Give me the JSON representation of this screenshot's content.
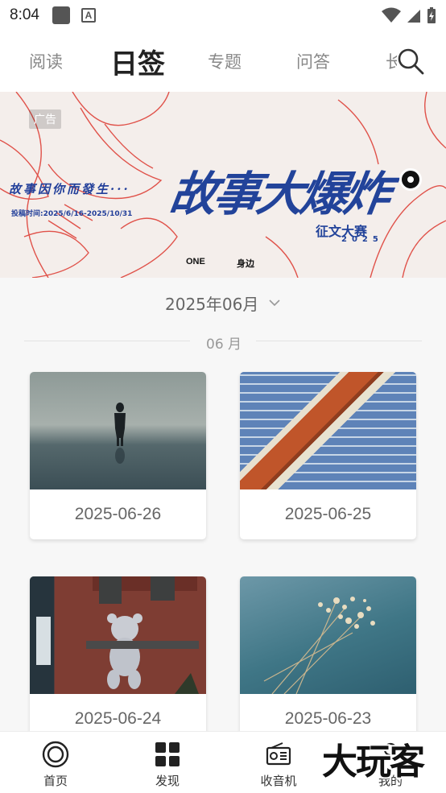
{
  "status_bar": {
    "time": "8:04",
    "notification_icon_letter": "A"
  },
  "top_tabs": [
    {
      "label": "阅读",
      "active": false
    },
    {
      "label": "日签",
      "active": true
    },
    {
      "label": "专题",
      "active": false
    },
    {
      "label": "问答",
      "active": false
    },
    {
      "label": "长",
      "active": false
    }
  ],
  "banner": {
    "ad_tag": "广告",
    "subtitle": "故事因你而發生···",
    "submission_period": "投稿时间:2025/6/16-2025/10/31",
    "title": "故事大爆炸",
    "contest": "征文大赛",
    "year": "2025",
    "brand_one": "ONE",
    "brand_side": "身边"
  },
  "month_selector": {
    "value": "2025年06月"
  },
  "month_heading": "06 月",
  "cards": [
    {
      "date": "2025-06-26",
      "image": "person-standing-in-sea"
    },
    {
      "date": "2025-06-25",
      "image": "mosaic-tiles"
    },
    {
      "date": "2025-06-24",
      "image": "teddy-bear-on-building"
    },
    {
      "date": "2025-06-23",
      "image": "dried-flowers-bouquet"
    }
  ],
  "bottom_nav": [
    {
      "label": "首页",
      "icon": "home-circle-icon"
    },
    {
      "label": "发现",
      "icon": "grid-icon"
    },
    {
      "label": "收音机",
      "icon": "radio-icon"
    },
    {
      "label": "我的",
      "icon": "user-icon"
    }
  ],
  "watermark": "大玩客",
  "colors": {
    "banner_blue": "#22439a",
    "banner_red": "#e0524a",
    "background": "#f7f7f7"
  }
}
